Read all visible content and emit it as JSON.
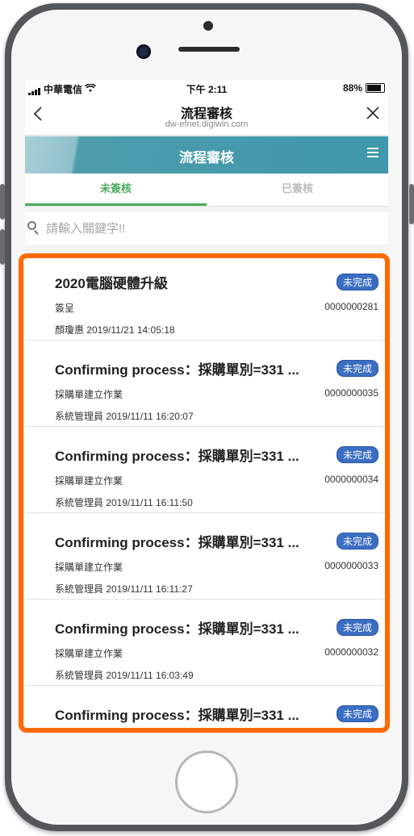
{
  "status_bar": {
    "carrier": "中華電信",
    "time": "下午 2:11",
    "battery": "88%"
  },
  "nav": {
    "title": "流程審核",
    "subtitle": "dw-efnet.digiwin.com",
    "back_icon": "chevron-left-icon",
    "close_icon": "close-icon"
  },
  "app_bar": {
    "title": "流程審核",
    "menu_icon": "hamburger-menu-icon",
    "color": "#3f98ab"
  },
  "tabs": [
    {
      "label": "未簽核"
    },
    {
      "label": "已簽核"
    }
  ],
  "search": {
    "placeholder": "請輸入關鍵字!!"
  },
  "items": [
    {
      "title": "2020電腦硬體升級",
      "badge": "未完成",
      "type": "簽呈",
      "number": "0000000281",
      "meta": "顏瓊惠 2019/11/21 14:05:18"
    },
    {
      "title": "Confirming process：採購單別=331 ...",
      "badge": "未完成",
      "type": "採購單建立作業",
      "number": "0000000035",
      "meta": "系統管理員 2019/11/11 16:20:07"
    },
    {
      "title": "Confirming process：採購單別=331 ...",
      "badge": "未完成",
      "type": "採購單建立作業",
      "number": "0000000034",
      "meta": "系統管理員 2019/11/11 16:11:50"
    },
    {
      "title": "Confirming process：採購單別=331 ...",
      "badge": "未完成",
      "type": "採購單建立作業",
      "number": "0000000033",
      "meta": "系統管理員 2019/11/11 16:11:27"
    },
    {
      "title": "Confirming process：採購單別=331 ...",
      "badge": "未完成",
      "type": "採購單建立作業",
      "number": "0000000032",
      "meta": "系統管理員 2019/11/11 16:03:49"
    },
    {
      "title": "Confirming process：採購單別=331 ...",
      "badge": "未完成"
    }
  ],
  "colors": {
    "accent_green": "#4aab5a",
    "badge_blue": "#3b6ec2",
    "highlight_orange": "#ff6a00"
  }
}
